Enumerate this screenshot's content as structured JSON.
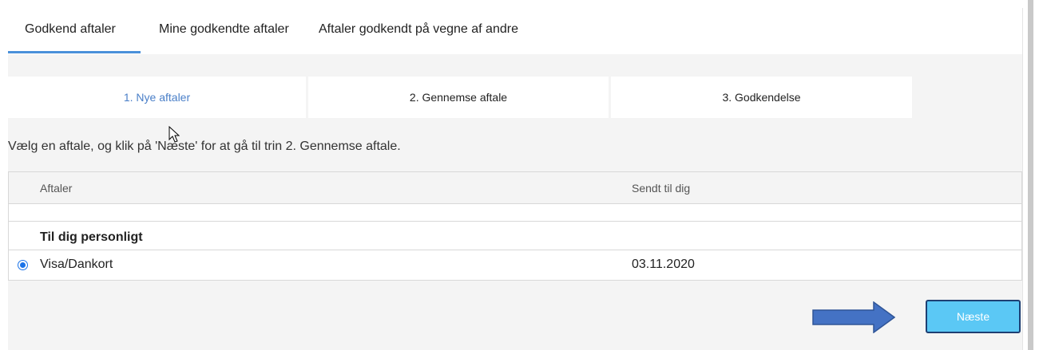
{
  "tabs": [
    {
      "label": "Godkend aftaler",
      "active": true
    },
    {
      "label": "Mine godkendte aftaler",
      "active": false
    },
    {
      "label": "Aftaler godkendt på vegne af andre",
      "active": false
    }
  ],
  "steps": [
    {
      "label": "1. Nye aftaler",
      "active": true
    },
    {
      "label": "2. Gennemse aftale",
      "active": false
    },
    {
      "label": "3. Godkendelse",
      "active": false
    }
  ],
  "instruction": "Vælg en aftale, og klik på 'Næste' for at gå til trin 2. Gennemse aftale.",
  "table": {
    "headers": [
      "Aftaler",
      "Sendt til dig"
    ],
    "group_label": "Til dig personligt",
    "rows": [
      {
        "name": "Visa/Dankort",
        "date": "03.11.2020",
        "selected": true
      }
    ]
  },
  "next_button": {
    "label": "Næste"
  },
  "colors": {
    "accent": "#4a90d9",
    "button_bg": "#5bc8f5",
    "button_border": "#1e3f73",
    "arrow": "#4472c4"
  }
}
